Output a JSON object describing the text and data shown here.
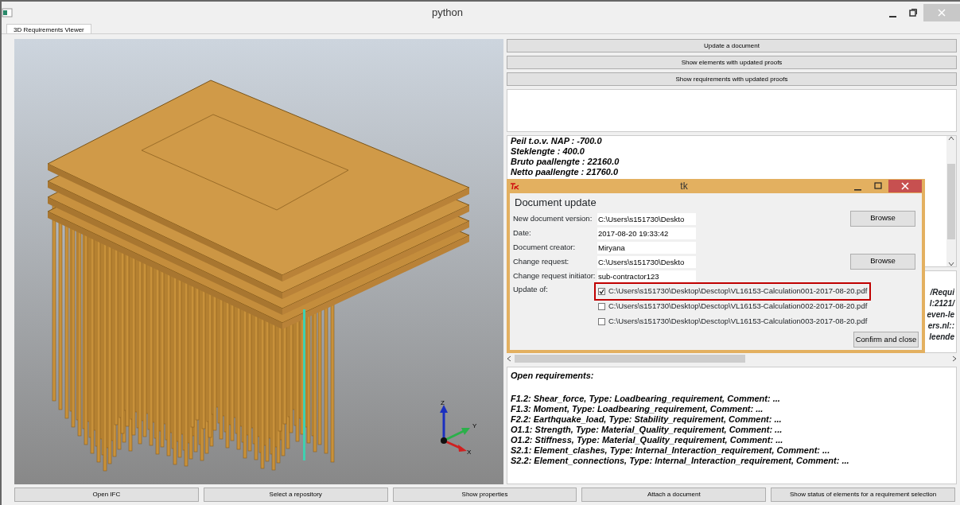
{
  "window": {
    "title": "python"
  },
  "tabs": [
    {
      "label": "3D Requirements Viewer",
      "selected": true
    }
  ],
  "top_buttons": [
    "Update a document",
    "Show elements with updated proofs",
    "Show requirements with updated proofs"
  ],
  "properties_text": [
    "Peil t.o.v. NAP : -700.0",
    "Steklengte : 400.0",
    "Bruto paallengte : 22160.0",
    "Netto paallengte : 21760.0"
  ],
  "axis_labels": [
    "Z",
    "Y",
    "X"
  ],
  "info_fragments": [
    "/Requi",
    "l:2121/",
    "even-le",
    "ers.nl::",
    "leende"
  ],
  "open_requirements": {
    "title": "Open requirements:",
    "items": [
      "F1.2: Shear_force, Type: Loadbearing_requirement, Comment: ...",
      "F1.3: Moment, Type: Loadbearing_requirement, Comment: ...",
      "F2.2: Earthquake_load, Type: Stability_requirement, Comment: ...",
      "O1.1: Strength, Type: Material_Quality_requirement, Comment: ...",
      "O1.2: Stiffness, Type: Material_Quality_requirement, Comment: ...",
      "S2.1: Element_clashes, Type: Internal_Interaction_requirement, Comment: ...",
      "S2.2: Element_connections, Type: Internal_Interaction_requirement, Comment: ..."
    ]
  },
  "bottom_buttons": [
    "Open IFC",
    "Select a repository",
    "Show properties",
    "Attach a document",
    "Show status of elements for a requirement selection"
  ],
  "dialog": {
    "title": "tk",
    "heading": "Document update",
    "fields": [
      {
        "label": "New document version:",
        "value": "C:\\Users\\s151730\\Deskto",
        "browse": "Browse"
      },
      {
        "label": "Date:",
        "value": "2017-08-20 19:33:42"
      },
      {
        "label": "Document creator:",
        "value": "Miryana"
      },
      {
        "label": "Change request:",
        "value": "C:\\Users\\s151730\\Deskto",
        "browse": "Browse"
      },
      {
        "label": "Change request initiator:",
        "value": "sub-contractor123"
      }
    ],
    "update_label": "Update of:",
    "documents": [
      {
        "path": "C:\\Users\\s151730\\Desktop\\Desctop\\VL16153-Calculation001-2017-08-20.pdf",
        "checked": true,
        "highlighted": true
      },
      {
        "path": "C:\\Users\\s151730\\Desktop\\Desctop\\VL16153-Calculation002-2017-08-20.pdf",
        "checked": false,
        "highlighted": false
      },
      {
        "path": "C:\\Users\\s151730\\Desktop\\Desctop\\VL16153-Calculation003-2017-08-20.pdf",
        "checked": false,
        "highlighted": false
      }
    ],
    "confirm": "Confirm and close"
  }
}
